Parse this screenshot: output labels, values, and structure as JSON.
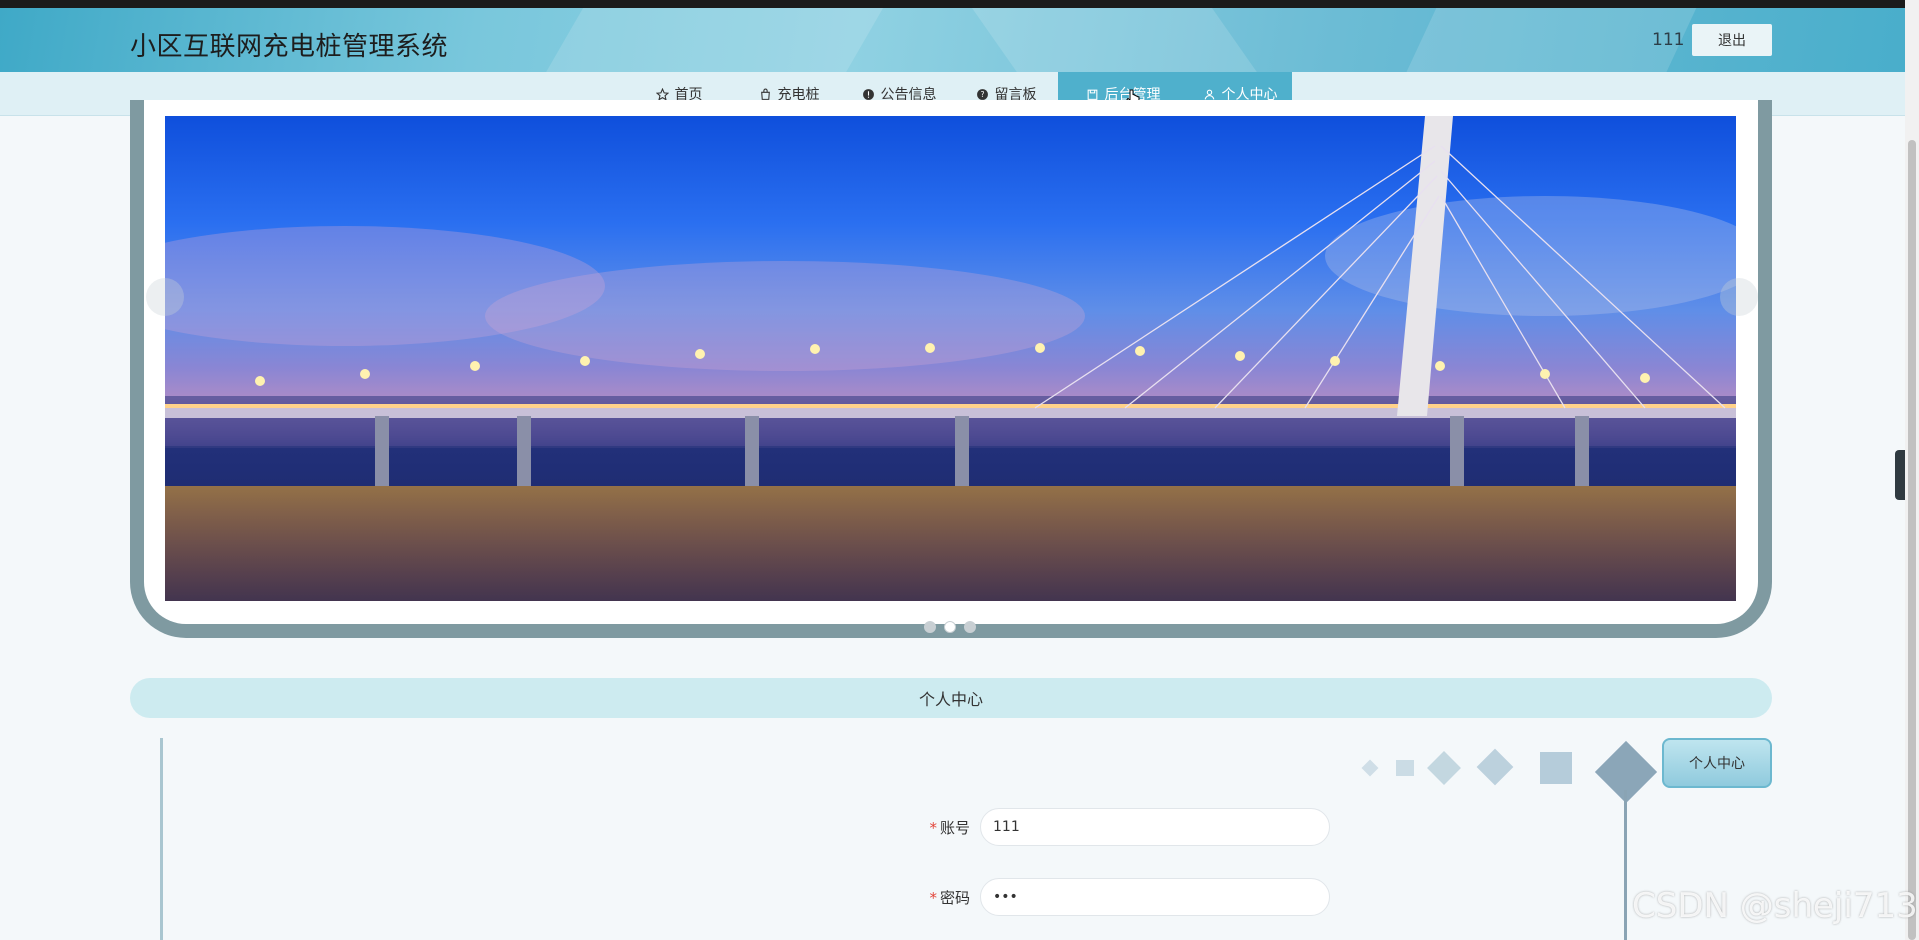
{
  "header": {
    "site_title": "小区互联网充电桩管理系统",
    "username": "111",
    "logout_label": "退出"
  },
  "nav": {
    "items": [
      {
        "label": "首页",
        "icon": "star-icon"
      },
      {
        "label": "充电桩",
        "icon": "bag-icon"
      },
      {
        "label": "公告信息",
        "icon": "info-icon"
      },
      {
        "label": "留言板",
        "icon": "help-icon"
      },
      {
        "label": "后台管理",
        "icon": "dashboard-icon"
      },
      {
        "label": "个人中心",
        "icon": "user-icon"
      }
    ],
    "active_index": 4
  },
  "carousel": {
    "slide_count": 3,
    "active_slide": 1,
    "image": "night-bridge-photo"
  },
  "section": {
    "title": "个人中心"
  },
  "profile_button_label": "个人中心",
  "form": {
    "fields": [
      {
        "label": "账号",
        "required": true,
        "value": "111"
      },
      {
        "label": "密码",
        "required": true,
        "value": "•••"
      }
    ]
  },
  "watermark": "CSDN @sheji713",
  "colors": {
    "accent": "#4fb0cc",
    "header": "#79c7dc",
    "required": "#e2463b"
  }
}
